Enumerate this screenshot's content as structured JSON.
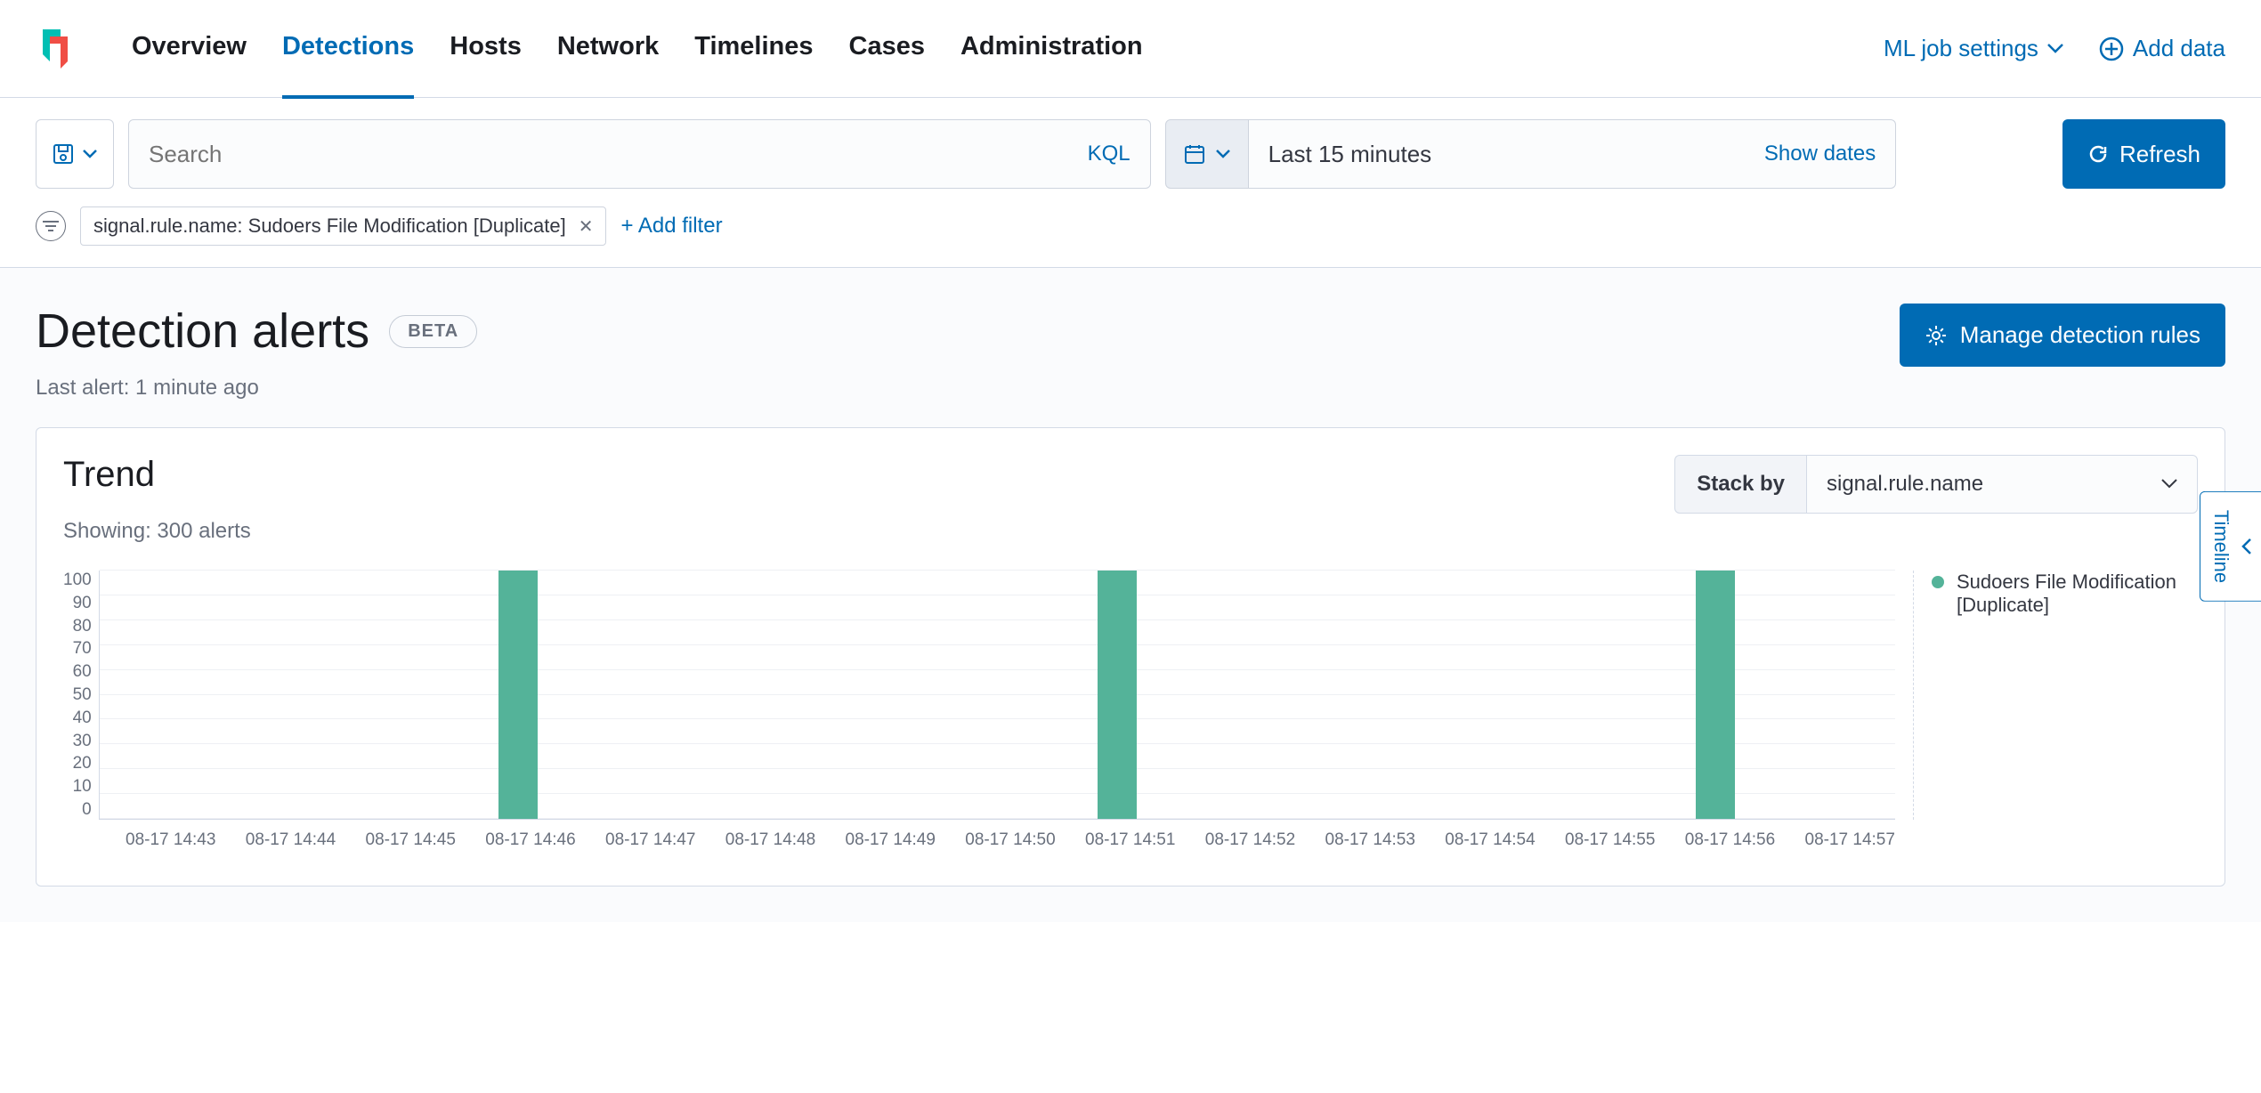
{
  "nav": {
    "items": [
      "Overview",
      "Detections",
      "Hosts",
      "Network",
      "Timelines",
      "Cases",
      "Administration"
    ],
    "active": "Detections"
  },
  "header": {
    "ml_settings": "ML job settings",
    "add_data": "Add data"
  },
  "query": {
    "search_placeholder": "Search",
    "kql": "KQL",
    "date_range": "Last 15 minutes",
    "show_dates": "Show dates",
    "refresh": "Refresh"
  },
  "filters": {
    "pill": "signal.rule.name: Sudoers File Modification [Duplicate]",
    "add_filter": "+ Add filter"
  },
  "page": {
    "title": "Detection alerts",
    "badge": "BETA",
    "manage_rules": "Manage detection rules",
    "last_alert": "Last alert: 1 minute ago"
  },
  "panel": {
    "title": "Trend",
    "stack_by_label": "Stack by",
    "stack_by_value": "signal.rule.name",
    "showing": "Showing: 300 alerts",
    "legend": "Sudoers File Modification [Duplicate]"
  },
  "chart_data": {
    "type": "bar",
    "xlabel": "",
    "ylabel": "",
    "ylim": [
      0,
      100
    ],
    "y_ticks": [
      100,
      90,
      80,
      70,
      60,
      50,
      40,
      30,
      20,
      10,
      0
    ],
    "categories": [
      "08-17 14:43",
      "08-17 14:44",
      "08-17 14:45",
      "08-17 14:46",
      "08-17 14:47",
      "08-17 14:48",
      "08-17 14:49",
      "08-17 14:50",
      "08-17 14:51",
      "08-17 14:52",
      "08-17 14:53",
      "08-17 14:54",
      "08-17 14:55",
      "08-17 14:56",
      "08-17 14:57"
    ],
    "series": [
      {
        "name": "Sudoers File Modification [Duplicate]",
        "color": "#54b399",
        "values": [
          0,
          0,
          0,
          100,
          0,
          0,
          0,
          0,
          100,
          0,
          0,
          0,
          0,
          100,
          0
        ]
      }
    ]
  },
  "flyout": {
    "timeline": "Timeline"
  }
}
